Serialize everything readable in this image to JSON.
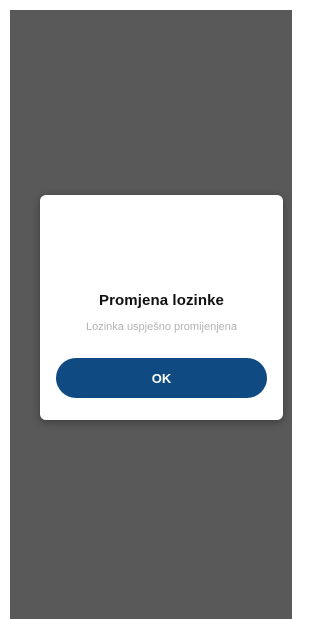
{
  "dialog": {
    "title": "Promjena lozinke",
    "message": "Lozinka uspješno promijenjena",
    "ok_label": "OK"
  },
  "colors": {
    "overlay": "#595959",
    "dialog_background": "#ffffff",
    "button_background": "#0f4a82",
    "button_text": "#ffffff",
    "message_text": "#b3b3b3"
  }
}
